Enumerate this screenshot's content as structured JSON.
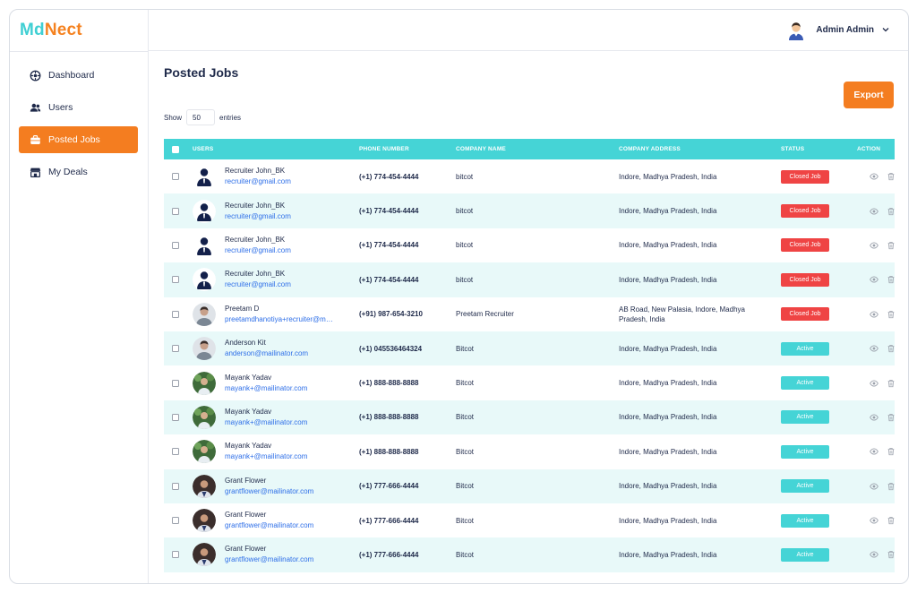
{
  "brand": {
    "part1": "Md",
    "part2": "Nect",
    "color1": "#3fcfd3",
    "color2": "#f58220"
  },
  "accent": "#f47d20",
  "table_header_color": "#45d4d6",
  "sidebar": {
    "items": [
      {
        "label": "Dashboard",
        "icon": "dashboard-icon",
        "active": false
      },
      {
        "label": "Users",
        "icon": "users-icon",
        "active": false
      },
      {
        "label": "Posted Jobs",
        "icon": "briefcase-icon",
        "active": true
      },
      {
        "label": "My Deals",
        "icon": "store-icon",
        "active": false
      }
    ]
  },
  "header": {
    "user_name": "Admin Admin"
  },
  "main": {
    "title": "Posted Jobs",
    "export_label": "Export",
    "show_label": "Show",
    "entries_value": "50",
    "entries_label": "entries"
  },
  "table": {
    "columns": [
      "USERS",
      "PHONE NUMBER",
      "COMPANY NAME",
      "COMPANY ADDRESS",
      "STATUS",
      "ACTION"
    ],
    "rows": [
      {
        "name": "Recruiter John_BK",
        "email": "recruiter@gmail.com",
        "phone": "(+1) 774-454-4444",
        "company": "bitcot",
        "address": "Indore, Madhya Pradesh, India",
        "status": "Closed Job",
        "avatar": "silhouette"
      },
      {
        "name": "Recruiter John_BK",
        "email": "recruiter@gmail.com",
        "phone": "(+1) 774-454-4444",
        "company": "bitcot",
        "address": "Indore, Madhya Pradesh, India",
        "status": "Closed Job",
        "avatar": "silhouette"
      },
      {
        "name": "Recruiter John_BK",
        "email": "recruiter@gmail.com",
        "phone": "(+1) 774-454-4444",
        "company": "bitcot",
        "address": "Indore, Madhya Pradesh, India",
        "status": "Closed Job",
        "avatar": "silhouette"
      },
      {
        "name": "Recruiter John_BK",
        "email": "recruiter@gmail.com",
        "phone": "(+1) 774-454-4444",
        "company": "bitcot",
        "address": "Indore, Madhya Pradesh, India",
        "status": "Closed Job",
        "avatar": "silhouette"
      },
      {
        "name": "Preetam D",
        "email": "preetamdhanotiya+recruiter@mailinator.com",
        "phone": "(+91) 987-654-3210",
        "company": "Preetam Recruiter",
        "address": "AB Road, New Palasia, Indore, Madhya Pradesh, India",
        "status": "Closed Job",
        "avatar": "photo-grey"
      },
      {
        "name": "Anderson Kit",
        "email": "anderson@mailinator.com",
        "phone": "(+1) 045536464324",
        "company": "Bitcot",
        "address": "Indore, Madhya Pradesh, India",
        "status": "Active",
        "avatar": "photo-grey"
      },
      {
        "name": "Mayank Yadav",
        "email": "mayank+@mailinator.com",
        "phone": "(+1) 888-888-8888",
        "company": "Bitcot",
        "address": "Indore, Madhya Pradesh, India",
        "status": "Active",
        "avatar": "photo-green"
      },
      {
        "name": "Mayank Yadav",
        "email": "mayank+@mailinator.com",
        "phone": "(+1) 888-888-8888",
        "company": "Bitcot",
        "address": "Indore, Madhya Pradesh, India",
        "status": "Active",
        "avatar": "photo-green"
      },
      {
        "name": "Mayank Yadav",
        "email": "mayank+@mailinator.com",
        "phone": "(+1) 888-888-8888",
        "company": "Bitcot",
        "address": "Indore, Madhya Pradesh, India",
        "status": "Active",
        "avatar": "photo-green"
      },
      {
        "name": "Grant Flower",
        "email": "grantflower@mailinator.com",
        "phone": "(+1) 777-666-4444",
        "company": "Bitcot",
        "address": "Indore, Madhya Pradesh, India",
        "status": "Active",
        "avatar": "photo-dark"
      },
      {
        "name": "Grant Flower",
        "email": "grantflower@mailinator.com",
        "phone": "(+1) 777-666-4444",
        "company": "Bitcot",
        "address": "Indore, Madhya Pradesh, India",
        "status": "Active",
        "avatar": "photo-dark"
      },
      {
        "name": "Grant Flower",
        "email": "grantflower@mailinator.com",
        "phone": "(+1) 777-666-4444",
        "company": "Bitcot",
        "address": "Indore, Madhya Pradesh, India",
        "status": "Active",
        "avatar": "photo-dark"
      }
    ]
  }
}
